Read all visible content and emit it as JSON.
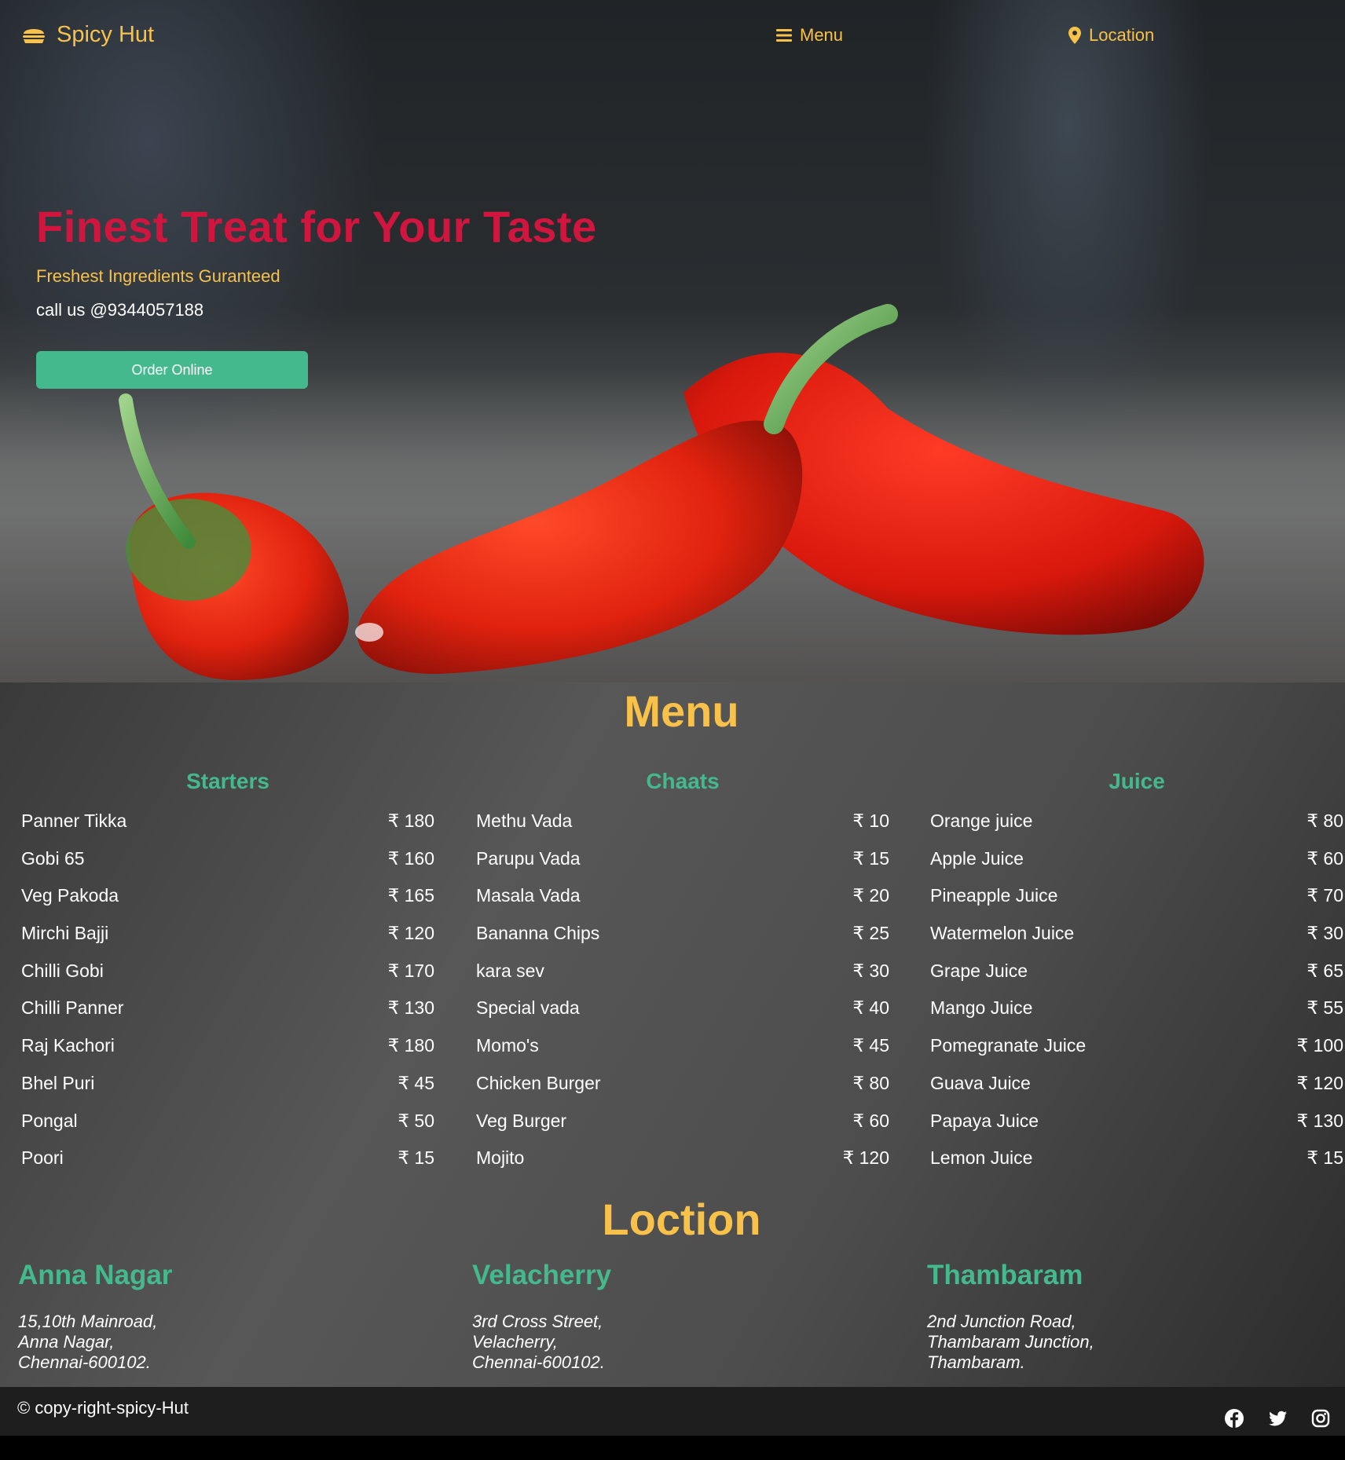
{
  "navbar": {
    "brand": "Spicy Hut",
    "brand_icon": "burger-icon",
    "menu_label": "Menu",
    "menu_icon": "hamburger-icon",
    "location_label": "Location",
    "location_icon": "map-pin-icon"
  },
  "hero": {
    "title": "Finest Treat for Your Taste",
    "subtitle": "Freshest Ingredients Guranteed",
    "call": "call us @9344057188",
    "button": "Order Online"
  },
  "menu": {
    "title": "Menu",
    "columns": [
      {
        "heading": "Starters",
        "items": [
          {
            "name": "Panner Tikka",
            "price": "₹ 180"
          },
          {
            "name": "Gobi 65",
            "price": "₹ 160"
          },
          {
            "name": "Veg Pakoda",
            "price": "₹ 165"
          },
          {
            "name": "Mirchi Bajji",
            "price": "₹ 120"
          },
          {
            "name": "Chilli Gobi",
            "price": "₹ 170"
          },
          {
            "name": "Chilli Panner",
            "price": "₹ 130"
          },
          {
            "name": "Raj Kachori",
            "price": "₹ 180"
          },
          {
            "name": "Bhel Puri",
            "price": "₹ 45"
          },
          {
            "name": "Pongal",
            "price": "₹ 50"
          },
          {
            "name": "Poori",
            "price": "₹ 15"
          }
        ]
      },
      {
        "heading": "Chaats",
        "items": [
          {
            "name": "Methu Vada",
            "price": "₹ 10"
          },
          {
            "name": "Parupu Vada",
            "price": "₹ 15"
          },
          {
            "name": "Masala Vada",
            "price": "₹ 20"
          },
          {
            "name": "Bananna Chips",
            "price": "₹ 25"
          },
          {
            "name": "kara sev",
            "price": "₹ 30"
          },
          {
            "name": "Special vada",
            "price": "₹ 40"
          },
          {
            "name": "Momo's",
            "price": "₹ 45"
          },
          {
            "name": "Chicken Burger",
            "price": "₹ 80"
          },
          {
            "name": "Veg Burger",
            "price": "₹ 60"
          },
          {
            "name": "Mojito",
            "price": "₹ 120"
          }
        ]
      },
      {
        "heading": "Juice",
        "items": [
          {
            "name": "Orange juice",
            "price": "₹ 80"
          },
          {
            "name": "Apple Juice",
            "price": "₹ 60"
          },
          {
            "name": "Pineapple Juice",
            "price": "₹ 70"
          },
          {
            "name": "Watermelon Juice",
            "price": "₹ 30"
          },
          {
            "name": "Grape Juice",
            "price": "₹ 65"
          },
          {
            "name": "Mango Juice",
            "price": "₹ 55"
          },
          {
            "name": "Pomegranate Juice",
            "price": "₹ 100"
          },
          {
            "name": "Guava Juice",
            "price": "₹ 120"
          },
          {
            "name": "Papaya Juice",
            "price": "₹ 130"
          },
          {
            "name": "Lemon Juice",
            "price": "₹ 15"
          }
        ]
      }
    ]
  },
  "locations": {
    "title": "Loction",
    "branches": [
      {
        "name": "Anna Nagar",
        "lines": [
          "15,10th Mainroad,",
          "Anna Nagar,",
          "Chennai-600102."
        ]
      },
      {
        "name": "Velacherry",
        "lines": [
          "3rd Cross Street,",
          "Velacherry,",
          "Chennai-600102."
        ]
      },
      {
        "name": "Thambaram",
        "lines": [
          "2nd Junction Road,",
          "Thambaram Junction,",
          "Thambaram."
        ]
      }
    ]
  },
  "footer": {
    "copyright": "© copy-right-spicy-Hut",
    "social": [
      "facebook-icon",
      "twitter-icon",
      "instagram-icon"
    ]
  },
  "colors": {
    "accent_yellow": "#f8c14a",
    "accent_green": "#45b98e",
    "hero_title_red": "#d0163e"
  }
}
